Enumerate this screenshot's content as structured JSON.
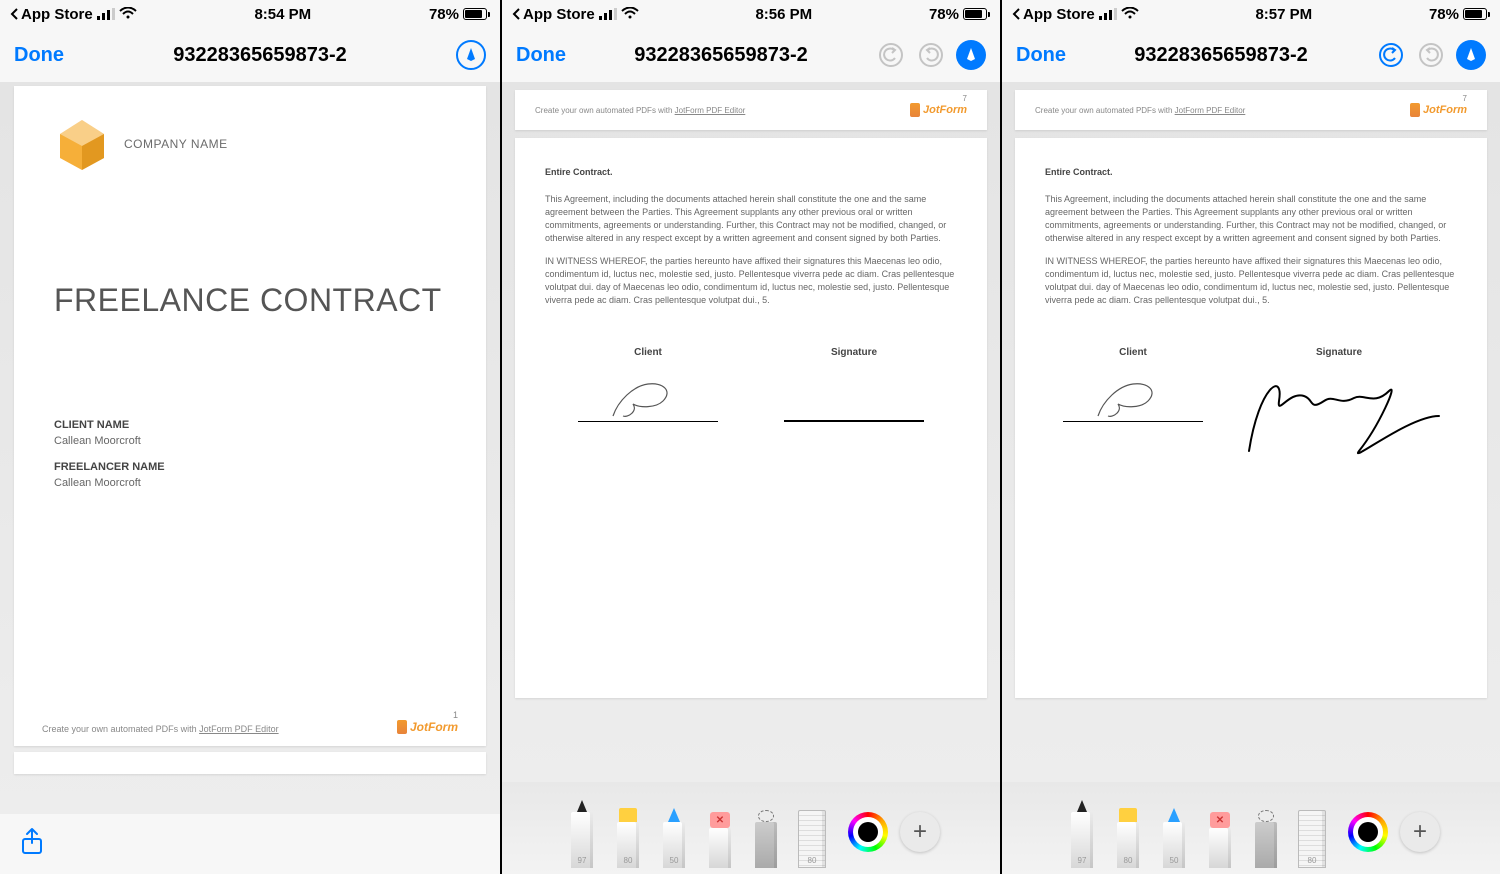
{
  "screens": [
    {
      "status": {
        "back": "App Store",
        "time": "8:54 PM",
        "battery": "78%"
      },
      "nav": {
        "done": "Done",
        "title": "93228365659873-2",
        "undo": false,
        "redo": false,
        "markup": true
      }
    },
    {
      "status": {
        "back": "App Store",
        "time": "8:56 PM",
        "battery": "78%"
      },
      "nav": {
        "done": "Done",
        "title": "93228365659873-2",
        "undo_enabled": false,
        "redo_enabled": false,
        "markup": true
      }
    },
    {
      "status": {
        "back": "App Store",
        "time": "8:57 PM",
        "battery": "78%"
      },
      "nav": {
        "done": "Done",
        "title": "93228365659873-2",
        "undo_enabled": true,
        "redo_enabled": false,
        "markup": true
      }
    }
  ],
  "doc": {
    "company": "COMPANY NAME",
    "title": "FREELANCE CONTRACT",
    "client_label": "CLIENT NAME",
    "client_value": "Callean Moorcroft",
    "freelancer_label": "FREELANCER NAME",
    "freelancer_value": "Callean Moorcroft",
    "footer_text": "Create your own automated PDFs with ",
    "footer_link": "JotForm PDF Editor",
    "brand": "JotForm",
    "page7": {
      "num": "7",
      "heading": "Entire Contract.",
      "p1": "This Agreement, including the documents attached herein shall constitute the one and the same agreement between the Parties. This Agreement supplants any other previous oral or written commitments, agreements or understanding. Further, this Contract may not be modified, changed, or otherwise altered in any respect except by a written agreement and consent signed by both Parties.",
      "p2": "IN WITNESS WHEREOF, the parties hereunto have affixed their signatures this Maecenas leo odio, condimentum id, luctus nec, molestie sed, justo. Pellentesque viverra pede ac diam. Cras pellentesque volutpat dui. day of Maecenas leo odio, condimentum id, luctus nec, molestie sed, justo. Pellentesque viverra pede ac diam. Cras pellentesque volutpat dui., 5.",
      "sig1_label": "Client",
      "sig2_label": "Signature"
    },
    "page1_num": "1"
  },
  "tools": {
    "pen_num": "97",
    "hl_num": "80",
    "pencil_num": "50",
    "ruler_num": "80"
  }
}
